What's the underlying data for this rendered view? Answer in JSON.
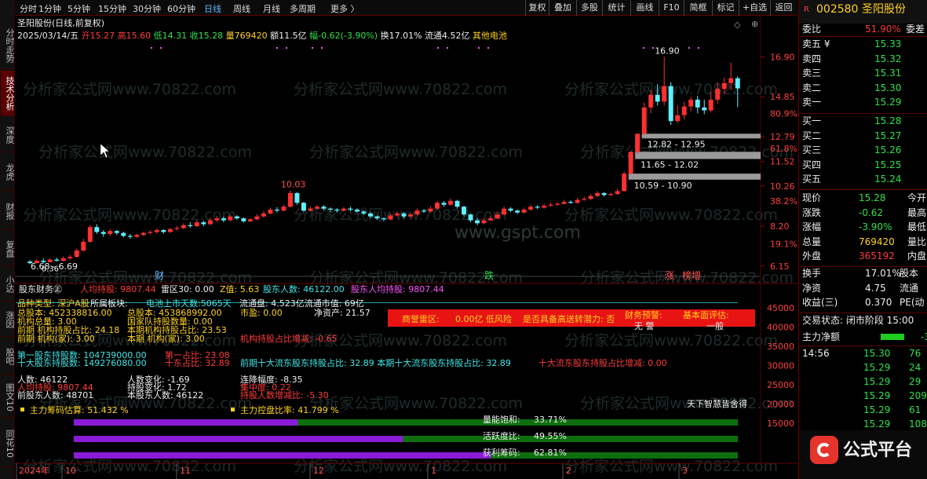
{
  "sidebar_tabs": [
    "分时走势",
    "技术分析",
    "深度",
    "龙虎",
    "财报",
    "复盘",
    "小达",
    "涨因",
    "股吧",
    "图文10",
    "同花10"
  ],
  "sidebar_active": 1,
  "toolbar_left": [
    "分时",
    "1分钟",
    "5分钟",
    "15分钟",
    "30分钟",
    "60分钟",
    "日线",
    "周线",
    "月线",
    "多周期",
    "更多 〉"
  ],
  "toolbar_right": [
    "复权",
    "叠加",
    "多股",
    "统计",
    "画线",
    "F10",
    "简框",
    "标记",
    "+自选",
    "返回"
  ],
  "info": {
    "name": "圣阳股份",
    "period": "(日线,前复权)",
    "date": "2025/03/14/五",
    "open": "开15.27",
    "high": "高15.60",
    "low": "低14.31",
    "close": "收15.28",
    "volume": "量769420",
    "amount": "额11.5亿",
    "change": "幅-0.62(-3.90%)",
    "turnover": "换17.01%",
    "float": "流通4.52亿",
    "concept": "其他电池"
  },
  "watermark": "分析家公式网www.70822.com",
  "site_wm": "www.gspt.com",
  "chart_data": {
    "type": "candlestick",
    "ylim": [
      5.9,
      17.4
    ],
    "y_ticks": [
      16.9,
      14.85,
      12.79,
      11.52,
      10.26,
      8.2,
      6.15
    ],
    "y_pct_ticks": [
      {
        "label": "80.9%",
        "v": 14.0
      },
      {
        "label": "61.8%",
        "v": 12.2
      },
      {
        "label": "38.2%",
        "v": 9.5
      },
      {
        "label": "19.1%",
        "v": 7.3
      }
    ],
    "candles": [
      [
        6.38,
        6.3,
        6.45,
        6.25
      ],
      [
        6.3,
        6.42,
        6.5,
        6.28
      ],
      [
        6.42,
        6.35,
        6.55,
        6.3
      ],
      [
        6.35,
        6.48,
        6.55,
        6.33
      ],
      [
        6.48,
        6.42,
        6.58,
        6.38
      ],
      [
        6.42,
        6.55,
        6.65,
        6.4
      ],
      [
        6.55,
        6.62,
        6.72,
        6.48
      ],
      [
        6.62,
        6.95,
        7.05,
        6.58
      ],
      [
        6.95,
        7.4,
        7.55,
        6.9
      ],
      [
        7.4,
        8.15,
        8.25,
        7.35
      ],
      [
        8.15,
        7.9,
        8.3,
        7.8
      ],
      [
        7.9,
        7.8,
        8.0,
        7.65
      ],
      [
        7.8,
        7.95,
        8.05,
        7.7
      ],
      [
        7.95,
        7.85,
        8.0,
        7.75
      ],
      [
        7.85,
        7.7,
        7.92,
        7.62
      ],
      [
        7.7,
        7.65,
        7.8,
        7.55
      ],
      [
        7.65,
        7.75,
        7.82,
        7.6
      ],
      [
        7.75,
        7.85,
        7.92,
        7.68
      ],
      [
        7.85,
        7.9,
        7.98,
        7.78
      ],
      [
        7.9,
        8.0,
        8.08,
        7.82
      ],
      [
        8.0,
        7.9,
        8.05,
        7.82
      ],
      [
        7.9,
        8.05,
        8.12,
        7.85
      ],
      [
        8.05,
        8.1,
        8.22,
        7.98
      ],
      [
        8.1,
        8.25,
        8.35,
        8.05
      ],
      [
        8.25,
        8.2,
        8.4,
        8.12
      ],
      [
        8.2,
        8.4,
        8.52,
        8.15
      ],
      [
        8.4,
        8.3,
        8.48,
        8.2
      ],
      [
        8.3,
        8.5,
        8.62,
        8.25
      ],
      [
        8.5,
        8.6,
        8.72,
        8.42
      ],
      [
        8.6,
        8.5,
        8.68,
        8.4
      ],
      [
        8.5,
        8.7,
        8.8,
        8.45
      ],
      [
        8.7,
        8.6,
        8.76,
        8.52
      ],
      [
        8.6,
        8.45,
        8.65,
        8.38
      ],
      [
        8.45,
        8.55,
        8.62,
        8.4
      ],
      [
        8.55,
        8.7,
        8.82,
        8.5
      ],
      [
        8.7,
        8.85,
        8.98,
        8.65
      ],
      [
        8.85,
        9.05,
        9.15,
        8.8
      ],
      [
        9.05,
        9.0,
        9.18,
        8.9
      ],
      [
        9.0,
        9.2,
        9.3,
        8.95
      ],
      [
        9.2,
        9.9,
        10.03,
        9.15
      ],
      [
        9.9,
        9.4,
        9.95,
        9.3
      ],
      [
        9.4,
        9.0,
        9.45,
        8.92
      ],
      [
        9.0,
        9.1,
        9.2,
        8.95
      ],
      [
        9.1,
        9.2,
        9.3,
        9.05
      ],
      [
        9.2,
        9.1,
        9.28,
        9.0
      ],
      [
        9.1,
        9.05,
        9.15,
        8.95
      ],
      [
        9.05,
        9.0,
        9.12,
        8.9
      ],
      [
        9.0,
        9.1,
        9.18,
        8.95
      ],
      [
        9.1,
        9.05,
        9.2,
        8.98
      ],
      [
        9.05,
        8.95,
        9.12,
        8.88
      ],
      [
        8.95,
        8.85,
        9.0,
        8.78
      ],
      [
        8.85,
        8.7,
        8.92,
        8.62
      ],
      [
        8.7,
        8.6,
        8.75,
        8.52
      ],
      [
        8.6,
        8.55,
        8.66,
        8.45
      ],
      [
        8.55,
        8.75,
        8.85,
        8.5
      ],
      [
        8.75,
        8.85,
        8.95,
        8.7
      ],
      [
        8.85,
        8.7,
        8.92,
        8.62
      ],
      [
        8.7,
        8.8,
        8.9,
        8.65
      ],
      [
        8.8,
        9.0,
        9.12,
        8.75
      ],
      [
        9.0,
        8.95,
        9.08,
        8.88
      ],
      [
        8.95,
        9.1,
        9.22,
        8.9
      ],
      [
        9.1,
        9.4,
        9.5,
        9.05
      ],
      [
        9.4,
        9.3,
        9.48,
        9.2
      ],
      [
        9.3,
        9.5,
        9.62,
        9.25
      ],
      [
        9.5,
        9.2,
        9.55,
        9.1
      ],
      [
        9.2,
        8.8,
        9.25,
        8.7
      ],
      [
        8.8,
        8.5,
        8.85,
        8.4
      ],
      [
        8.5,
        8.35,
        8.6,
        8.25
      ],
      [
        8.35,
        8.5,
        8.62,
        8.3
      ],
      [
        8.5,
        8.6,
        8.72,
        8.45
      ],
      [
        8.6,
        8.8,
        8.92,
        8.55
      ],
      [
        8.8,
        9.1,
        9.2,
        8.75
      ],
      [
        9.1,
        9.0,
        9.18,
        8.92
      ],
      [
        9.0,
        8.9,
        9.05,
        8.82
      ],
      [
        8.9,
        9.05,
        9.15,
        8.85
      ],
      [
        9.05,
        9.2,
        9.3,
        9.0
      ],
      [
        9.2,
        9.15,
        9.28,
        9.08
      ],
      [
        9.15,
        9.25,
        9.35,
        9.1
      ],
      [
        9.25,
        9.3,
        9.4,
        9.2
      ],
      [
        9.3,
        9.35,
        9.45,
        9.25
      ],
      [
        9.35,
        9.45,
        9.55,
        9.3
      ],
      [
        9.45,
        9.4,
        9.52,
        9.35
      ],
      [
        9.4,
        9.55,
        9.65,
        9.35
      ],
      [
        9.55,
        9.6,
        9.7,
        9.5
      ],
      [
        9.6,
        9.75,
        9.85,
        9.55
      ],
      [
        9.75,
        9.9,
        10.0,
        9.7
      ],
      [
        9.9,
        9.8,
        9.95,
        9.72
      ],
      [
        9.8,
        9.85,
        9.92,
        9.75
      ],
      [
        9.85,
        10.0,
        10.12,
        9.8
      ],
      [
        10.0,
        10.9,
        11.0,
        9.98
      ],
      [
        10.9,
        12.02,
        12.02,
        10.85
      ],
      [
        12.02,
        12.95,
        12.95,
        11.9
      ],
      [
        12.95,
        14.3,
        14.55,
        12.9
      ],
      [
        14.3,
        14.95,
        15.2,
        14.0
      ],
      [
        14.95,
        14.6,
        15.5,
        14.4
      ],
      [
        14.6,
        15.4,
        16.9,
        14.4
      ],
      [
        15.4,
        13.6,
        15.6,
        13.4
      ],
      [
        13.6,
        13.9,
        14.4,
        13.5
      ],
      [
        13.9,
        14.35,
        14.6,
        13.7
      ],
      [
        14.35,
        14.7,
        14.85,
        14.1
      ],
      [
        14.7,
        14.3,
        14.9,
        14.0
      ],
      [
        14.3,
        14.15,
        14.7,
        13.95
      ],
      [
        14.15,
        14.7,
        15.1,
        14.05
      ],
      [
        14.7,
        15.25,
        15.6,
        14.5
      ],
      [
        15.25,
        15.55,
        15.85,
        15.0
      ],
      [
        15.55,
        15.8,
        16.6,
        15.2
      ],
      [
        15.8,
        15.28,
        15.9,
        14.31
      ]
    ],
    "labels": [
      {
        "text": "10.03",
        "i": 39
      },
      {
        "text": "16.90",
        "i": 95
      },
      {
        "text": "6.36",
        "i": 1,
        "low": true
      }
    ],
    "ma_start": "6.68 - 6.69",
    "gaps": [
      {
        "text": "12.82 - 12.95",
        "lo": 12.82,
        "hi": 12.95
      },
      {
        "text": "11.65 - 12.02",
        "lo": 11.65,
        "hi": 12.02
      },
      {
        "text": "10.59 - 10.90",
        "lo": 10.59,
        "hi": 10.9
      }
    ],
    "markers": [
      {
        "text": "财",
        "pos": "left"
      },
      {
        "text": "跌",
        "pos": "mid"
      },
      {
        "text": "涨",
        "pos": "r1"
      },
      {
        "text": "榜增",
        "pos": "r2"
      }
    ],
    "x_ticks": [
      "2024年",
      "10",
      "11",
      "12",
      "1",
      "2",
      "3"
    ]
  },
  "lower": {
    "title": "股东财务㊣",
    "p1": "人均持股: 9807.44",
    "p2": "雷区30: 0.00",
    "p3": "Z值: 5.63",
    "p4": "股东人数: 46122.00",
    "p5": "股东人均持股: 9807.44",
    "r1": [
      "品种类型: 深沪A股",
      "所属板块:",
      "电池上市天数:5065天",
      "流通盘: 4.523亿流通市值: 69亿"
    ],
    "r2": [
      "总股本: 452338816.00",
      "总股本: 453868992.00"
    ],
    "r3": [
      "机构总量: 3.00",
      "国家队持股数量: 0.00",
      "前期 机构持股占比: 24.18",
      "本期机构持股占比: 23.53"
    ],
    "r4": [
      "前期 机构(家): 3.00",
      "本期 机构(家): 3.00",
      "机构持股占比增减: -0.65"
    ],
    "pe": "市盈: 0.00",
    "nav": "净资产: 21.57",
    "banner": {
      "a": "商誉雷区:",
      "b": "0.00亿 低风险",
      "c": "是否具备高送转潜力: 否",
      "d": "财务预警:",
      "e": "基本面评估:",
      "f": "无 警",
      "g": "一般"
    },
    "r5": [
      "第一股东持股数: 104739000.00",
      "第一占比: 23.08"
    ],
    "r6": [
      "十大股东持股数: 149276080.00",
      "十东占比: 32.89",
      "前期十大流东股东持股占比: 32.89 本期十大流东股东持股占比: 32.89",
      "十大流东股东持股占比增减: 0.00"
    ],
    "r7": [
      "人数: 46122",
      "人数变化: -1.69",
      "连降幅度: -8.35"
    ],
    "r8": [
      "人均持股: 9807.44",
      "持股变化: 1.72",
      "集中度: 0.22"
    ],
    "r9": [
      "前股东人数: 48701",
      "本股东人数: 46122",
      "持股人数增减比: -5.30"
    ],
    "est1": "主力筹码估算: 51.432 %",
    "est2": "主力控盘比率: 41.799 %",
    "slogan": "天下智慧皆舍得",
    "bars": [
      {
        "label": "量能饱和:",
        "value": "33.71%",
        "pct": 33.71
      },
      {
        "label": "活跃度比:",
        "value": "49.55%",
        "pct": 49.55
      },
      {
        "label": "获利筹码:",
        "value": "62.81%",
        "pct": 62.81
      }
    ],
    "right_ticks": [
      "45000",
      "40000",
      "35000",
      "30000",
      "25000",
      "20000",
      "15000"
    ]
  },
  "quote": {
    "code": "002580",
    "name": "圣阳股份",
    "wb_label": "委比",
    "wb": "51.90%",
    "wc_label": "委差",
    "asks": [
      {
        "l": "卖五 ¥",
        "p": "15.33"
      },
      {
        "l": "卖四",
        "p": "15.32"
      },
      {
        "l": "卖三",
        "p": "15.31"
      },
      {
        "l": "卖二",
        "p": "15.30"
      },
      {
        "l": "卖一",
        "p": "15.29"
      }
    ],
    "bids": [
      {
        "l": "买一",
        "p": "15.28"
      },
      {
        "l": "买二",
        "p": "15.27"
      },
      {
        "l": "买三",
        "p": "15.26"
      },
      {
        "l": "买四",
        "p": "15.25"
      },
      {
        "l": "买五",
        "p": "15.24"
      }
    ],
    "stats": [
      {
        "l": "现价",
        "v": "15.28",
        "c": "green",
        "r": "今开"
      },
      {
        "l": "涨跌",
        "v": "-0.62",
        "c": "green",
        "r": "最高"
      },
      {
        "l": "涨幅",
        "v": "-3.90%",
        "c": "green",
        "r": "最低"
      },
      {
        "l": "总量",
        "v": "769420",
        "c": "yellow",
        "r": "量比"
      },
      {
        "l": "外盘",
        "v": "365192",
        "c": "red",
        "r": "内盘"
      }
    ],
    "stats2": [
      {
        "l": "换手",
        "v": "17.01%",
        "c": "white",
        "r": "股本"
      },
      {
        "l": "净资",
        "v": "4.75",
        "c": "white",
        "r": "流通"
      },
      {
        "l": "收益(三)",
        "v": "0.370",
        "c": "white",
        "r": "PE(动"
      }
    ],
    "status": "交易状态: 闭市阶段 15:00",
    "netflow_label": "主力净额",
    "netflow_r": "-3",
    "ticks": [
      {
        "t": "14:56",
        "p": "15.30",
        "v": "76"
      },
      {
        "t": "",
        "p": "15.29",
        "v": "24"
      },
      {
        "t": "",
        "p": "15.29",
        "v": "29"
      },
      {
        "t": "",
        "p": "15.29",
        "v": "209"
      },
      {
        "t": "",
        "p": "15.29",
        "v": "61"
      },
      {
        "t": "",
        "p": "15.29",
        "v": "108"
      }
    ],
    "logo": "公式平台"
  }
}
